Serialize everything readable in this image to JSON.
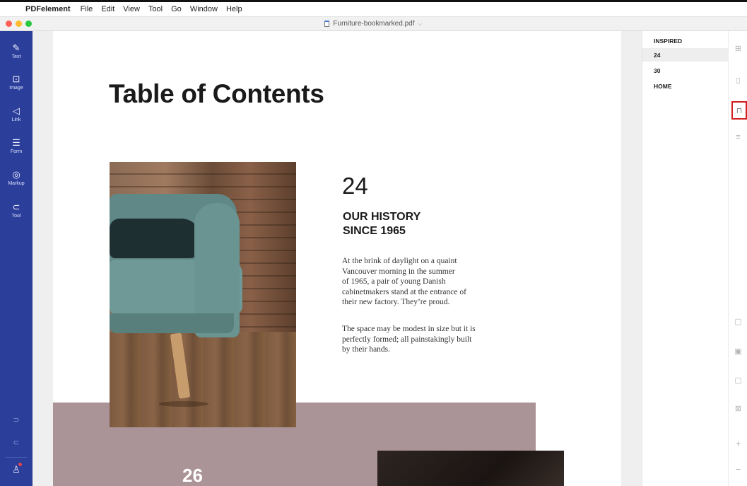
{
  "menubar": {
    "app_name": "PDFelement",
    "items": [
      "File",
      "Edit",
      "View",
      "Tool",
      "Go",
      "Window",
      "Help"
    ]
  },
  "window": {
    "title": "Furniture-bookmarked.pdf"
  },
  "left_toolbar": {
    "tools": [
      {
        "label": "Text",
        "icon": "pencil-icon"
      },
      {
        "label": "Image",
        "icon": "image-icon"
      },
      {
        "label": "Link",
        "icon": "link-icon"
      },
      {
        "label": "Form",
        "icon": "form-icon"
      },
      {
        "label": "Markup",
        "icon": "markup-icon"
      },
      {
        "label": "Tool",
        "icon": "tool-icon"
      }
    ],
    "accent": "#2b3e9a"
  },
  "document": {
    "heading": "Table of Contents",
    "section_number": "24",
    "section_title_line1": "OUR HISTORY",
    "section_title_line2": "SINCE 1965",
    "paragraph1_lines": [
      "At the brink of daylight on a quaint",
      "Vancouver morning in the summer",
      "of 1965, a pair of young Danish",
      "cabinetmakers stand at the entrance of",
      "their new factory. They’re proud."
    ],
    "paragraph2_lines": [
      "The space may be modest in size but it is",
      "perfectly formed; all painstakingly built",
      "by their hands."
    ],
    "next_section_number": "26",
    "band_color": "#ab9497"
  },
  "bookmarks": {
    "items": [
      "INSPIRED",
      "24",
      "30",
      "HOME"
    ],
    "selected": "24"
  },
  "right_strip": {
    "active": "bookmark-icon",
    "highlight_color": "#d02020"
  }
}
